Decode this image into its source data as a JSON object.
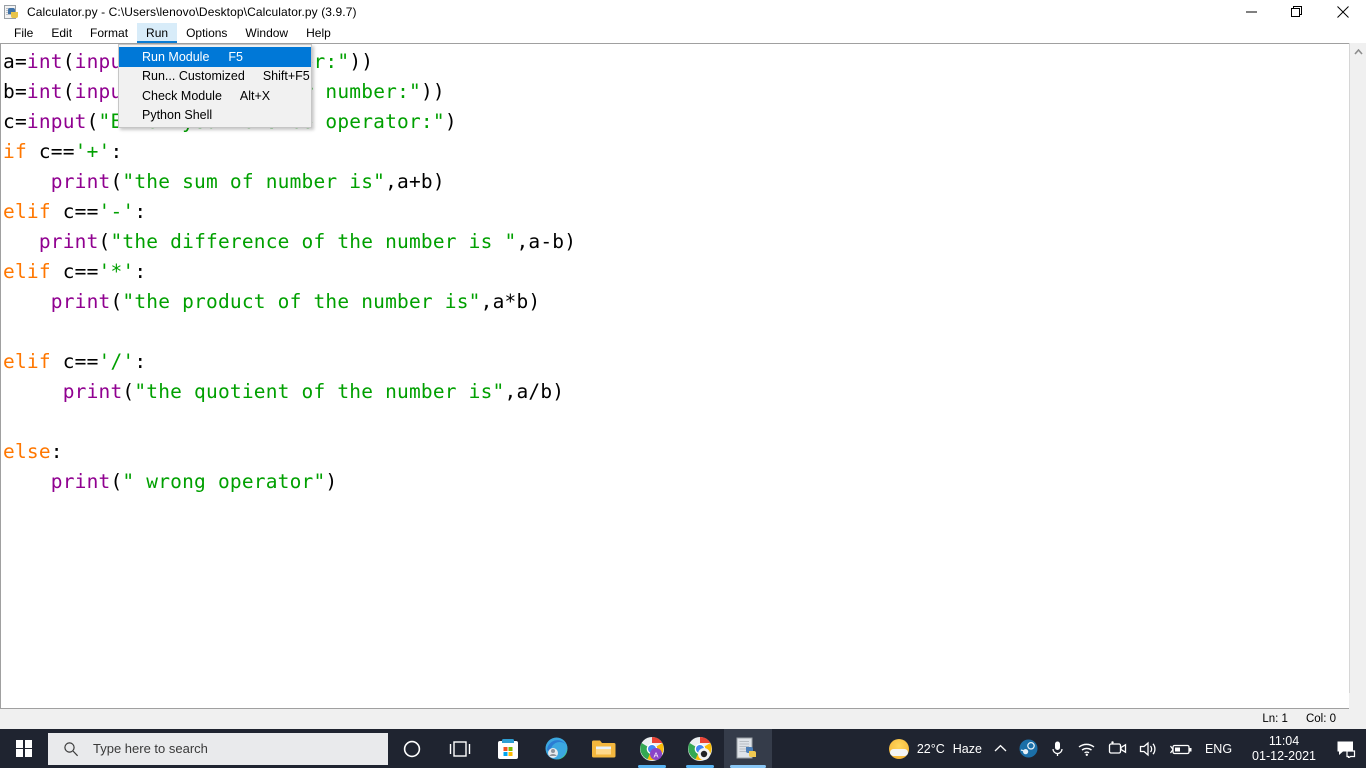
{
  "window": {
    "title": "Calculator.py - C:\\Users\\lenovo\\Desktop\\Calculator.py (3.9.7)",
    "icon": "python-file-icon",
    "controls": {
      "minimize": "Minimize",
      "restore": "Restore",
      "close": "Close"
    }
  },
  "menubar": {
    "items": [
      {
        "label": "File",
        "active": false
      },
      {
        "label": "Edit",
        "active": false
      },
      {
        "label": "Format",
        "active": false
      },
      {
        "label": "Run",
        "active": true
      },
      {
        "label": "Options",
        "active": false
      },
      {
        "label": "Window",
        "active": false
      },
      {
        "label": "Help",
        "active": false
      }
    ]
  },
  "run_menu": {
    "open": true,
    "items": [
      {
        "label": "Run Module",
        "accel": "F5",
        "selected": true
      },
      {
        "label": "Run... Customized",
        "accel": "Shift+F5",
        "selected": false
      },
      {
        "label": "Check Module",
        "accel": "Alt+X",
        "selected": false
      },
      {
        "label": "Python Shell",
        "accel": "",
        "selected": false
      }
    ]
  },
  "editor": {
    "colors": {
      "keyword": "#ff7700",
      "string": "#00a000",
      "builtin": "#900090",
      "default": "#000000",
      "background": "#ffffff"
    },
    "lines": [
      [
        {
          "t": "a=",
          "c": "d"
        },
        {
          "t": "int",
          "c": "fn"
        },
        {
          "t": "(",
          "c": "d"
        },
        {
          "t": "input",
          "c": "fn"
        },
        {
          "t": "(",
          "c": "d"
        },
        {
          "t": "\"Enter a number:\"",
          "c": "s"
        },
        {
          "t": "))",
          "c": "d"
        }
      ],
      [
        {
          "t": "b=",
          "c": "d"
        },
        {
          "t": "int",
          "c": "fn"
        },
        {
          "t": "(",
          "c": "d"
        },
        {
          "t": "input",
          "c": "fn"
        },
        {
          "t": "(",
          "c": "d"
        },
        {
          "t": "\"Enter another number:\"",
          "c": "s"
        },
        {
          "t": "))",
          "c": "d"
        }
      ],
      [
        {
          "t": "c=",
          "c": "d"
        },
        {
          "t": "input",
          "c": "fn"
        },
        {
          "t": "(",
          "c": "d"
        },
        {
          "t": "\"Enter your choice operator:\"",
          "c": "s"
        },
        {
          "t": ")",
          "c": "d"
        }
      ],
      [
        {
          "t": "if",
          "c": "k"
        },
        {
          "t": " c==",
          "c": "d"
        },
        {
          "t": "'+'",
          "c": "s"
        },
        {
          "t": ":",
          "c": "d"
        }
      ],
      [
        {
          "t": "    ",
          "c": "d"
        },
        {
          "t": "print",
          "c": "fn"
        },
        {
          "t": "(",
          "c": "d"
        },
        {
          "t": "\"the sum of number is\"",
          "c": "s"
        },
        {
          "t": ",a+b)",
          "c": "d"
        }
      ],
      [
        {
          "t": "elif",
          "c": "k"
        },
        {
          "t": " c==",
          "c": "d"
        },
        {
          "t": "'-'",
          "c": "s"
        },
        {
          "t": ":",
          "c": "d"
        }
      ],
      [
        {
          "t": "   ",
          "c": "d"
        },
        {
          "t": "print",
          "c": "fn"
        },
        {
          "t": "(",
          "c": "d"
        },
        {
          "t": "\"the difference of the number is \"",
          "c": "s"
        },
        {
          "t": ",a-b)",
          "c": "d"
        }
      ],
      [
        {
          "t": "elif",
          "c": "k"
        },
        {
          "t": " c==",
          "c": "d"
        },
        {
          "t": "'*'",
          "c": "s"
        },
        {
          "t": ":",
          "c": "d"
        }
      ],
      [
        {
          "t": "    ",
          "c": "d"
        },
        {
          "t": "print",
          "c": "fn"
        },
        {
          "t": "(",
          "c": "d"
        },
        {
          "t": "\"the product of the number is\"",
          "c": "s"
        },
        {
          "t": ",a*b)",
          "c": "d"
        }
      ],
      [],
      [
        {
          "t": "elif",
          "c": "k"
        },
        {
          "t": " c==",
          "c": "d"
        },
        {
          "t": "'/'",
          "c": "s"
        },
        {
          "t": ":",
          "c": "d"
        }
      ],
      [
        {
          "t": "     ",
          "c": "d"
        },
        {
          "t": "print",
          "c": "fn"
        },
        {
          "t": "(",
          "c": "d"
        },
        {
          "t": "\"the quotient of the number is\"",
          "c": "s"
        },
        {
          "t": ",a/b)",
          "c": "d"
        }
      ],
      [],
      [
        {
          "t": "else",
          "c": "k"
        },
        {
          "t": ":",
          "c": "d"
        }
      ],
      [
        {
          "t": "    ",
          "c": "d"
        },
        {
          "t": "print",
          "c": "fn"
        },
        {
          "t": "(",
          "c": "d"
        },
        {
          "t": "\" wrong operator\"",
          "c": "s"
        },
        {
          "t": ")",
          "c": "d"
        }
      ]
    ]
  },
  "statusbar": {
    "line": "Ln: 1",
    "column": "Col: 0"
  },
  "taskbar": {
    "search_placeholder": "Type here to search",
    "icons": [
      {
        "name": "cortana-icon"
      },
      {
        "name": "task-view-icon"
      },
      {
        "name": "microsoft-store-icon"
      },
      {
        "name": "microsoft-edge-icon"
      },
      {
        "name": "file-explorer-icon"
      },
      {
        "name": "chrome-icon"
      },
      {
        "name": "chrome-icon"
      },
      {
        "name": "python-idle-icon"
      }
    ],
    "tray": {
      "weather_temp": "22°C",
      "weather_cond": "Haze",
      "language": "ENG",
      "time": "11:04",
      "date": "01-12-2021"
    }
  }
}
